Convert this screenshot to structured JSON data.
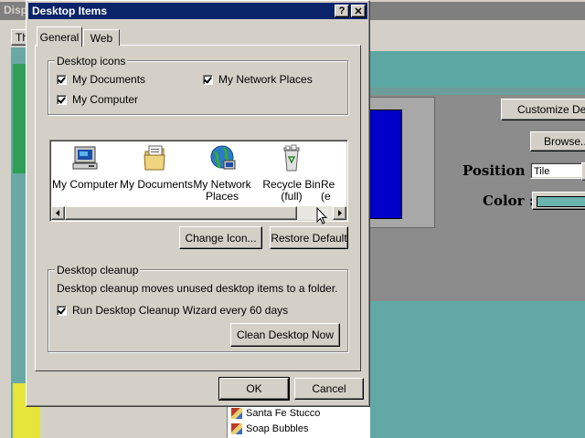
{
  "background_window": {
    "title": "Disp",
    "tab_partial": "Th",
    "customize_button": "Customize Desk",
    "browse_button": "Browse...",
    "position_label": "Position :",
    "position_value": "Tile",
    "color_label": "Color :",
    "pattern_list": [
      "Santa Fe Stucco",
      "Soap Bubbles"
    ]
  },
  "dialog": {
    "title": "Desktop Items",
    "help_button": "?",
    "close_button": "✕",
    "tabs": [
      {
        "label": "General",
        "active": true
      },
      {
        "label": "Web",
        "active": false
      }
    ],
    "desktop_icons": {
      "group_label": "Desktop icons",
      "checkboxes": [
        {
          "label": "My Documents",
          "checked": true
        },
        {
          "label": "My Computer",
          "checked": true
        },
        {
          "label": "My Network Places",
          "checked": true
        }
      ]
    },
    "icon_list": [
      {
        "label": "My Computer",
        "icon": "my-computer-icon"
      },
      {
        "label": "My Documents",
        "icon": "my-documents-icon"
      },
      {
        "label": "My Network\nPlaces",
        "icon": "network-places-icon"
      },
      {
        "label": "Recycle Bin\n(full)",
        "icon": "recycle-bin-full-icon"
      },
      {
        "label": "Re\n(e",
        "icon": "recycle-bin-empty-icon"
      }
    ],
    "change_icon_button": "Change Icon...",
    "restore_default_button": "Restore Default",
    "cleanup": {
      "group_label": "Desktop cleanup",
      "description": "Desktop cleanup moves unused desktop items to a folder.",
      "checkbox_label": "Run Desktop Cleanup Wizard every 60 days",
      "checkbox_checked": true,
      "clean_now_button": "Clean Desktop Now"
    },
    "ok_button": "OK",
    "cancel_button": "Cancel"
  }
}
